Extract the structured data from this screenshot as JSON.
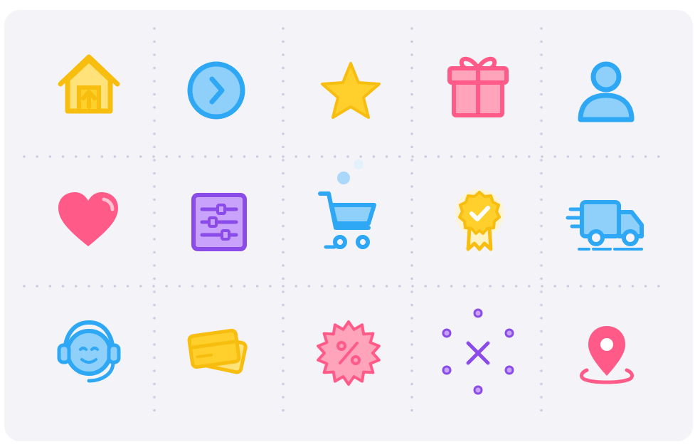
{
  "colors": {
    "yellow": "#ffd02b",
    "yellow_dark": "#f7bd0f",
    "blue": "#2ea8f5",
    "blue_light": "#8fd0fb",
    "pink": "#ff5a88",
    "pink_light": "#ffa4bb",
    "purple": "#8a4be8",
    "purple_light": "#c9a3fb",
    "grid_dot": "#c9cde0",
    "panel_bg": "#f4f4f8"
  },
  "icons": [
    {
      "name": "home-upload-icon",
      "color": "yellow"
    },
    {
      "name": "arrow-right-circle-icon",
      "color": "blue"
    },
    {
      "name": "star-icon",
      "color": "yellow"
    },
    {
      "name": "gift-icon",
      "color": "pink"
    },
    {
      "name": "user-icon",
      "color": "blue"
    },
    {
      "name": "heart-icon",
      "color": "pink"
    },
    {
      "name": "settings-sliders-icon",
      "color": "purple"
    },
    {
      "name": "shopping-cart-icon",
      "color": "blue"
    },
    {
      "name": "award-badge-icon",
      "color": "yellow"
    },
    {
      "name": "delivery-truck-icon",
      "color": "blue"
    },
    {
      "name": "customer-support-icon",
      "color": "blue"
    },
    {
      "name": "credit-cards-icon",
      "color": "yellow"
    },
    {
      "name": "discount-percent-icon",
      "color": "pink"
    },
    {
      "name": "close-sparkle-icon",
      "color": "purple"
    },
    {
      "name": "location-pin-icon",
      "color": "pink"
    }
  ]
}
